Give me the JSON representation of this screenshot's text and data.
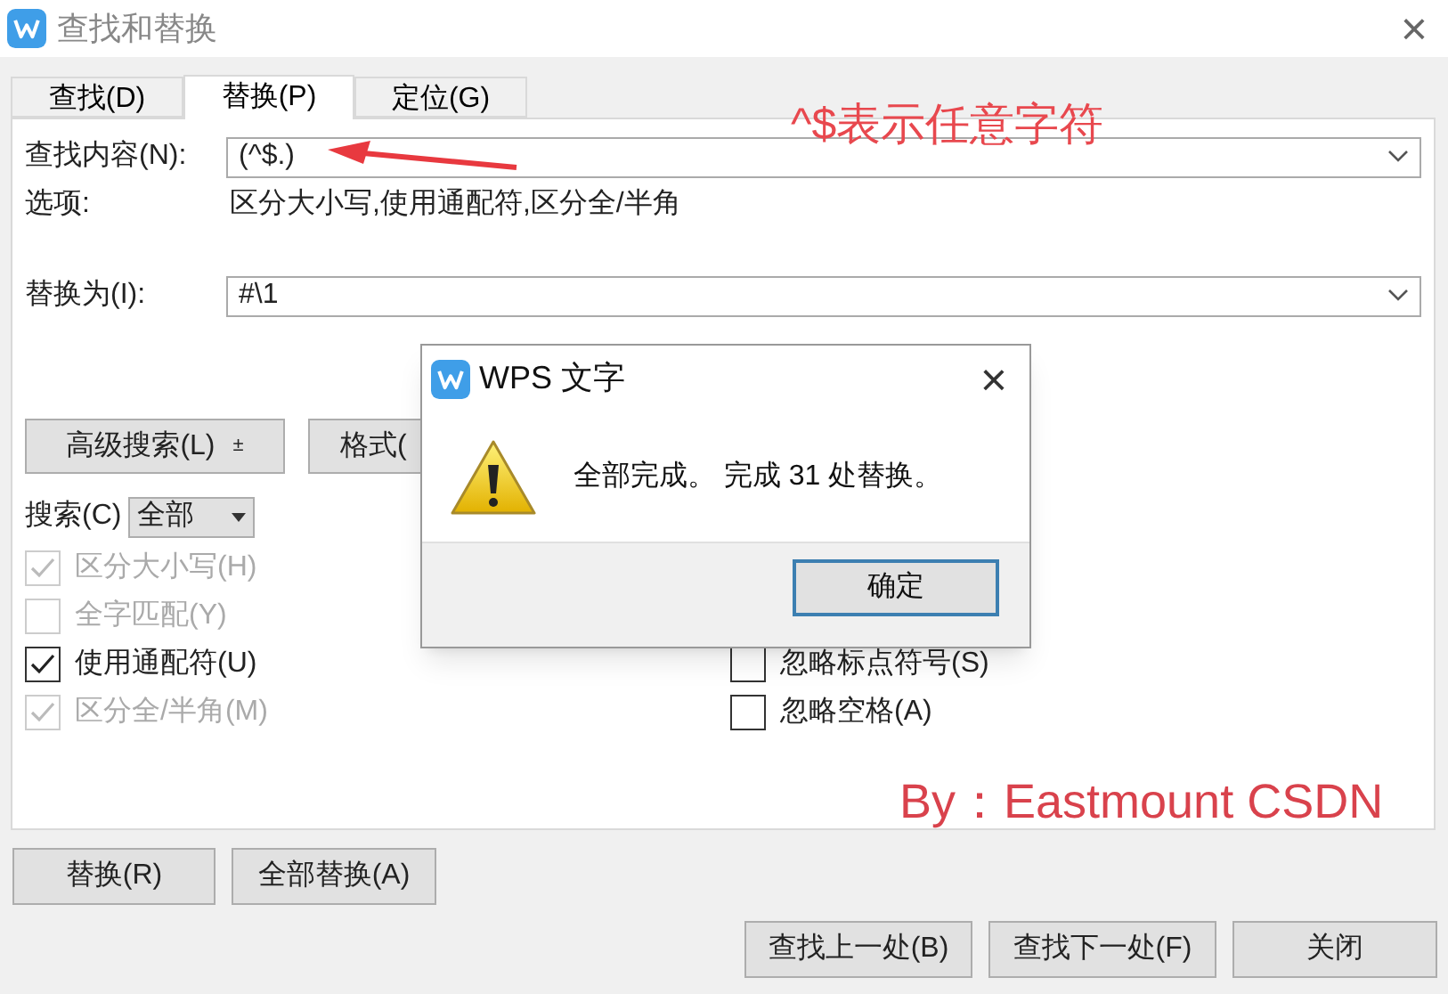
{
  "window": {
    "title": "查找和替换",
    "close": "×"
  },
  "tabs": [
    {
      "label": "查找(D)",
      "selected": false
    },
    {
      "label": "替换(P)",
      "selected": true
    },
    {
      "label": "定位(G)",
      "selected": false
    }
  ],
  "find": {
    "label": "查找内容(N):",
    "value": "(^$.)"
  },
  "options": {
    "label": "选项:",
    "value": "区分大小写,使用通配符,区分全/半角"
  },
  "replace": {
    "label": "替换为(I):",
    "value": "#\\1"
  },
  "advanced_button": {
    "label": "高级搜索(L)",
    "arrow": "±"
  },
  "format_button": {
    "label": "格式("
  },
  "search_scope": {
    "label": "搜索(C)",
    "value": "全部"
  },
  "checkboxes_left": [
    {
      "label": "区分大小写(H)",
      "checked": true,
      "disabled": true
    },
    {
      "label": "全字匹配(Y)",
      "checked": false,
      "disabled": true
    },
    {
      "label": "使用通配符(U)",
      "checked": true,
      "disabled": false
    },
    {
      "label": "区分全/半角(M)",
      "checked": true,
      "disabled": true
    }
  ],
  "checkboxes_right": [
    {
      "label": "忽略标点符号(S)",
      "checked": false,
      "disabled": false
    },
    {
      "label": "忽略空格(A)",
      "checked": false,
      "disabled": false
    }
  ],
  "replace_buttons": [
    "替换(R)",
    "全部替换(A)"
  ],
  "bottom_buttons": [
    "查找上一处(B)",
    "查找下一处(F)",
    "关闭"
  ],
  "annotations": [
    "^$表示任意字符",
    "By：Eastmount CSDN"
  ],
  "message_dialog": {
    "title": "WPS 文字",
    "close": "×",
    "message": "全部完成。 完成 31 处替换。",
    "button": "确定"
  }
}
